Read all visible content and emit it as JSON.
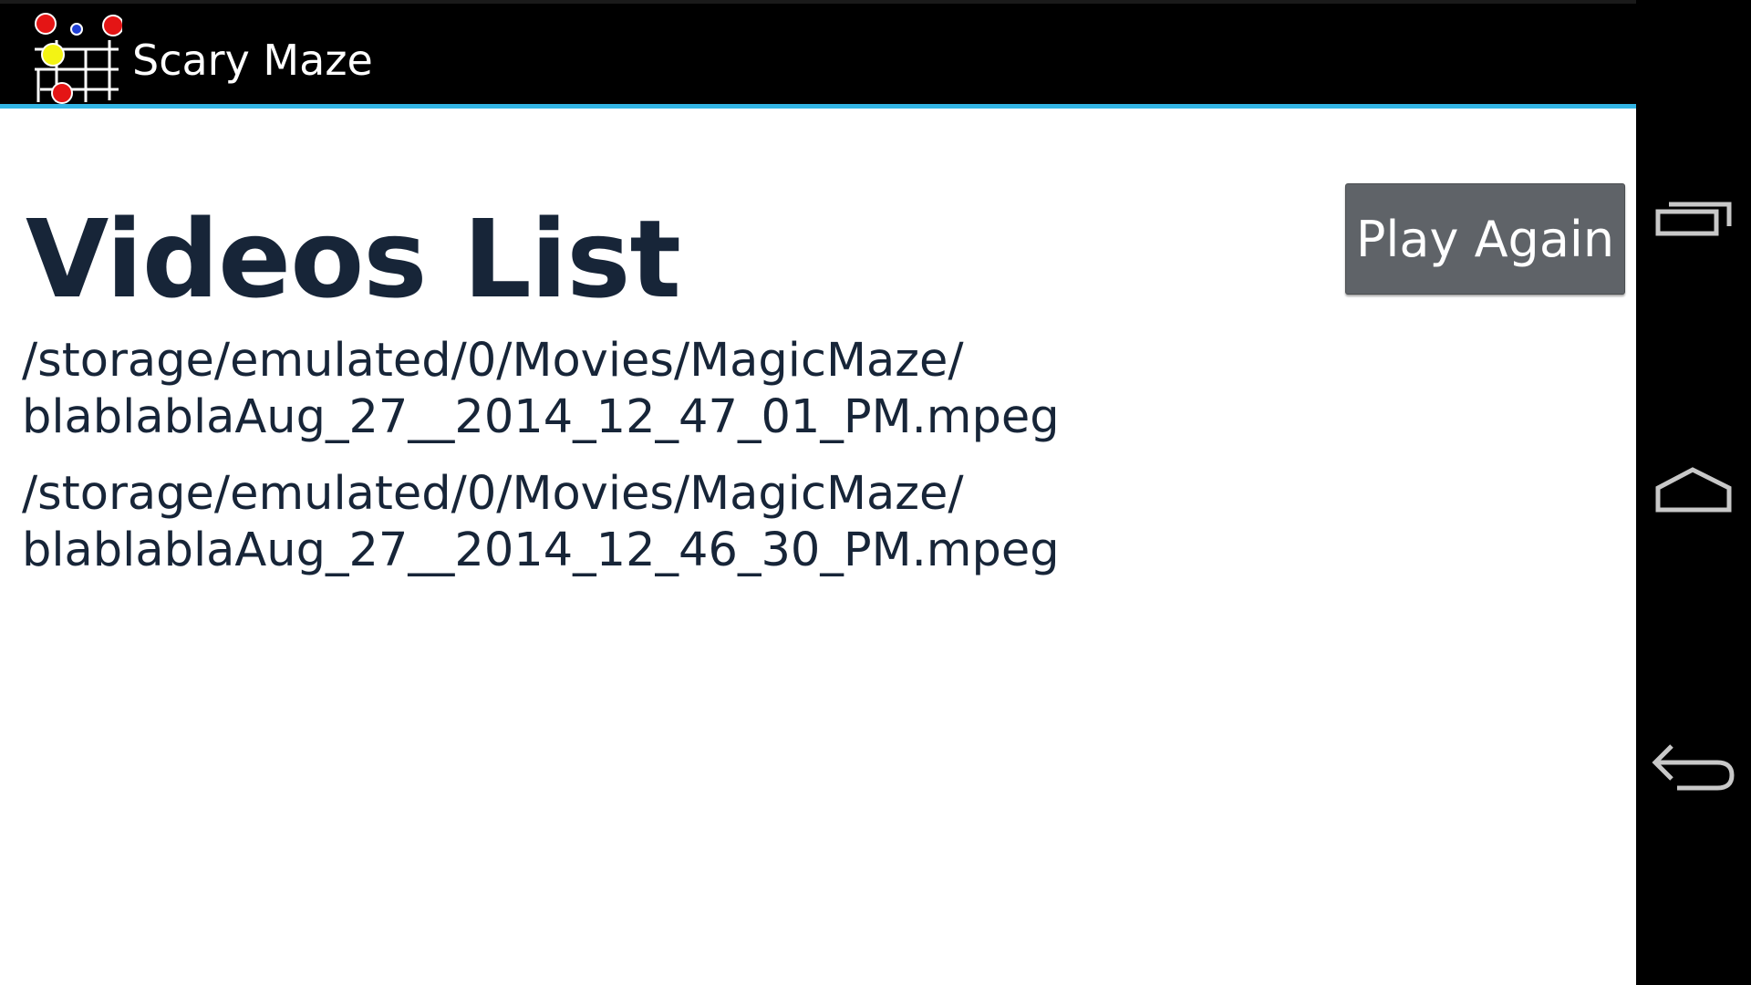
{
  "action_bar": {
    "title": "Scary Maze",
    "underline_color": "#33b5e5",
    "icon": "maze-app-icon"
  },
  "main": {
    "heading": "Videos List",
    "play_again_label": "Play Again",
    "videos": [
      {
        "line1": "/storage/emulated/0/Movies/MagicMaze/",
        "line2": "blablablaAug_27__2014_12_47_01_PM.mpeg"
      },
      {
        "line1": "/storage/emulated/0/Movies/MagicMaze/",
        "line2": "blablablaAug_27__2014_12_46_30_PM.mpeg"
      }
    ]
  },
  "nav_bar": {
    "buttons": [
      {
        "icon": "recent-apps-icon"
      },
      {
        "icon": "home-icon"
      },
      {
        "icon": "back-icon"
      }
    ]
  },
  "colors": {
    "text_dark": "#172538",
    "button_bg": "#5f6368",
    "accent": "#33b5e5"
  }
}
